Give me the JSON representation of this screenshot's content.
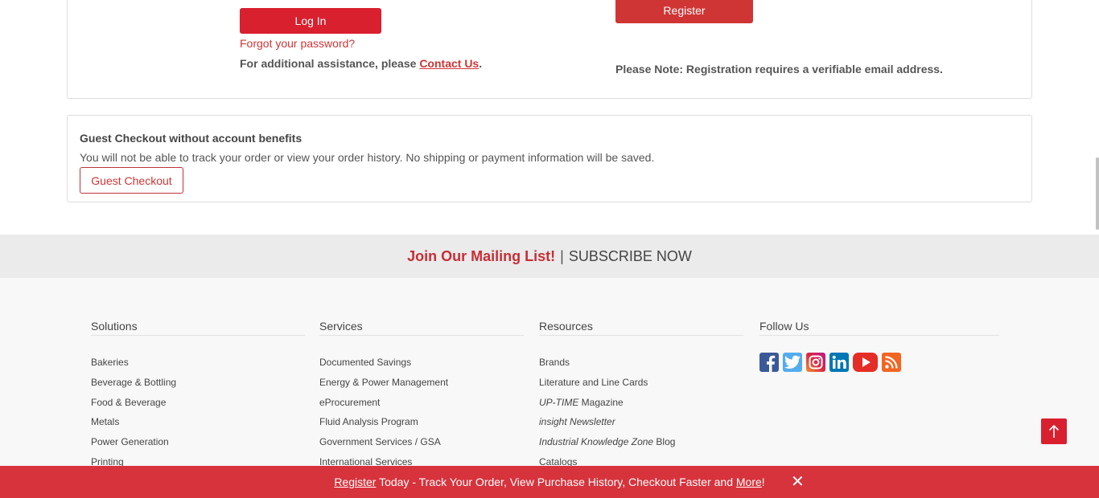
{
  "login": {
    "login_button": "Log In",
    "forgot_password": "Forgot your password?",
    "assistance_prefix": "For additional assistance, please ",
    "contact_link": "Contact Us",
    "assistance_suffix": ".",
    "register_button": "Register",
    "registration_note": "Please Note: Registration requires a verifiable email address."
  },
  "guest": {
    "title": "Guest Checkout without account benefits",
    "description": "You will not be able to track your order or view your order history. No shipping or payment information will be saved.",
    "button": "Guest Checkout"
  },
  "mailing": {
    "join": "Join Our Mailing List!",
    "separator": "|",
    "subscribe": "SUBSCRIBE NOW"
  },
  "footer": {
    "solutions": {
      "heading": "Solutions",
      "items": [
        "Bakeries",
        "Beverage & Bottling",
        "Food & Beverage",
        "Metals",
        "Power Generation",
        "Printing"
      ]
    },
    "services": {
      "heading": "Services",
      "items": [
        "Documented Savings",
        "Energy & Power Management",
        "eProcurement",
        "Fluid Analysis Program",
        "Government Services / GSA",
        "International Services"
      ]
    },
    "resources": {
      "heading": "Resources",
      "brands": "Brands",
      "literature": "Literature and Line Cards",
      "uptime_italic": "UP-TIME",
      "uptime_rest": " Magazine",
      "insight": "insight Newsletter",
      "ikz_italic": "Industrial Knowledge Zone",
      "ikz_rest": " Blog",
      "catalogs": "Catalogs"
    },
    "follow": {
      "heading": "Follow Us",
      "icons": [
        "facebook-icon",
        "twitter-icon",
        "instagram-icon",
        "linkedin-icon",
        "youtube-icon",
        "rss-icon"
      ]
    }
  },
  "banner": {
    "register_link": "Register",
    "middle": " Today - Track Your Order, View Purchase History, Checkout Faster and ",
    "more_link": "More",
    "end": "!",
    "close": "✕"
  },
  "colors": {
    "brand_red": "#d9202f",
    "banner_red": "#d7333c",
    "mailing_bg": "#ebebeb"
  }
}
